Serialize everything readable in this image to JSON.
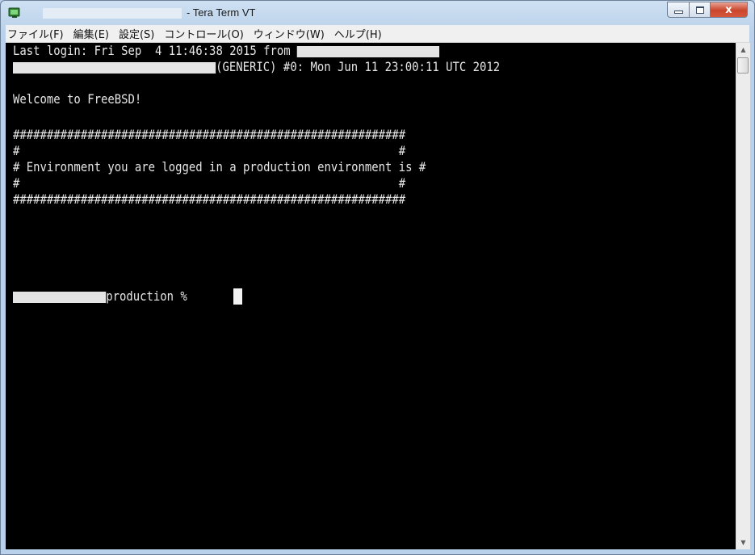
{
  "window": {
    "title": "- Tera Term VT",
    "close_glyph": "x"
  },
  "menu": [
    "ファイル(F)",
    "編集(E)",
    "設定(S)",
    "コントロール(O)",
    "ウィンドウ(W)",
    "ヘルプ(H)"
  ],
  "terminal": {
    "login": "Last login: Fri Sep  4 11:46:38 2015 from ",
    "kernel": "(GENERIC) #0: Mon Jun 11 23:00:11 UTC 2012",
    "welcome": "Welcome to FreeBSD!",
    "banner_border": "##########################################################",
    "banner_blank": "#                                                        #",
    "banner_message": "# Environment you are logged in a production environment is #",
    "prompt": "production % "
  },
  "scrollbar": {
    "up_icon": "▲",
    "down_icon": "▼"
  }
}
